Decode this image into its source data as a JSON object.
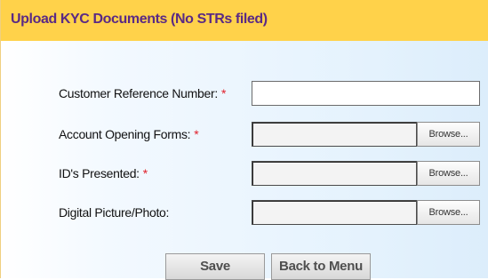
{
  "header": {
    "title": "Upload KYC Documents (No STRs filed)"
  },
  "form": {
    "required_marker": "*",
    "fields": [
      {
        "label": "Customer Reference Number:",
        "required": true,
        "type": "text",
        "value": ""
      },
      {
        "label": "Account Opening Forms:",
        "required": true,
        "type": "file",
        "browse_label": "Browse..."
      },
      {
        "label": "ID's Presented:",
        "required": true,
        "type": "file",
        "browse_label": "Browse..."
      },
      {
        "label": "Digital Picture/Photo:",
        "required": false,
        "type": "file",
        "browse_label": "Browse..."
      }
    ]
  },
  "actions": {
    "save_label": "Save",
    "back_label": "Back to Menu"
  },
  "colors": {
    "header_bg": "#ffd24a",
    "header_text": "#5a2a85",
    "required": "#e0202b",
    "panel_bg": "#e4f2fd"
  }
}
